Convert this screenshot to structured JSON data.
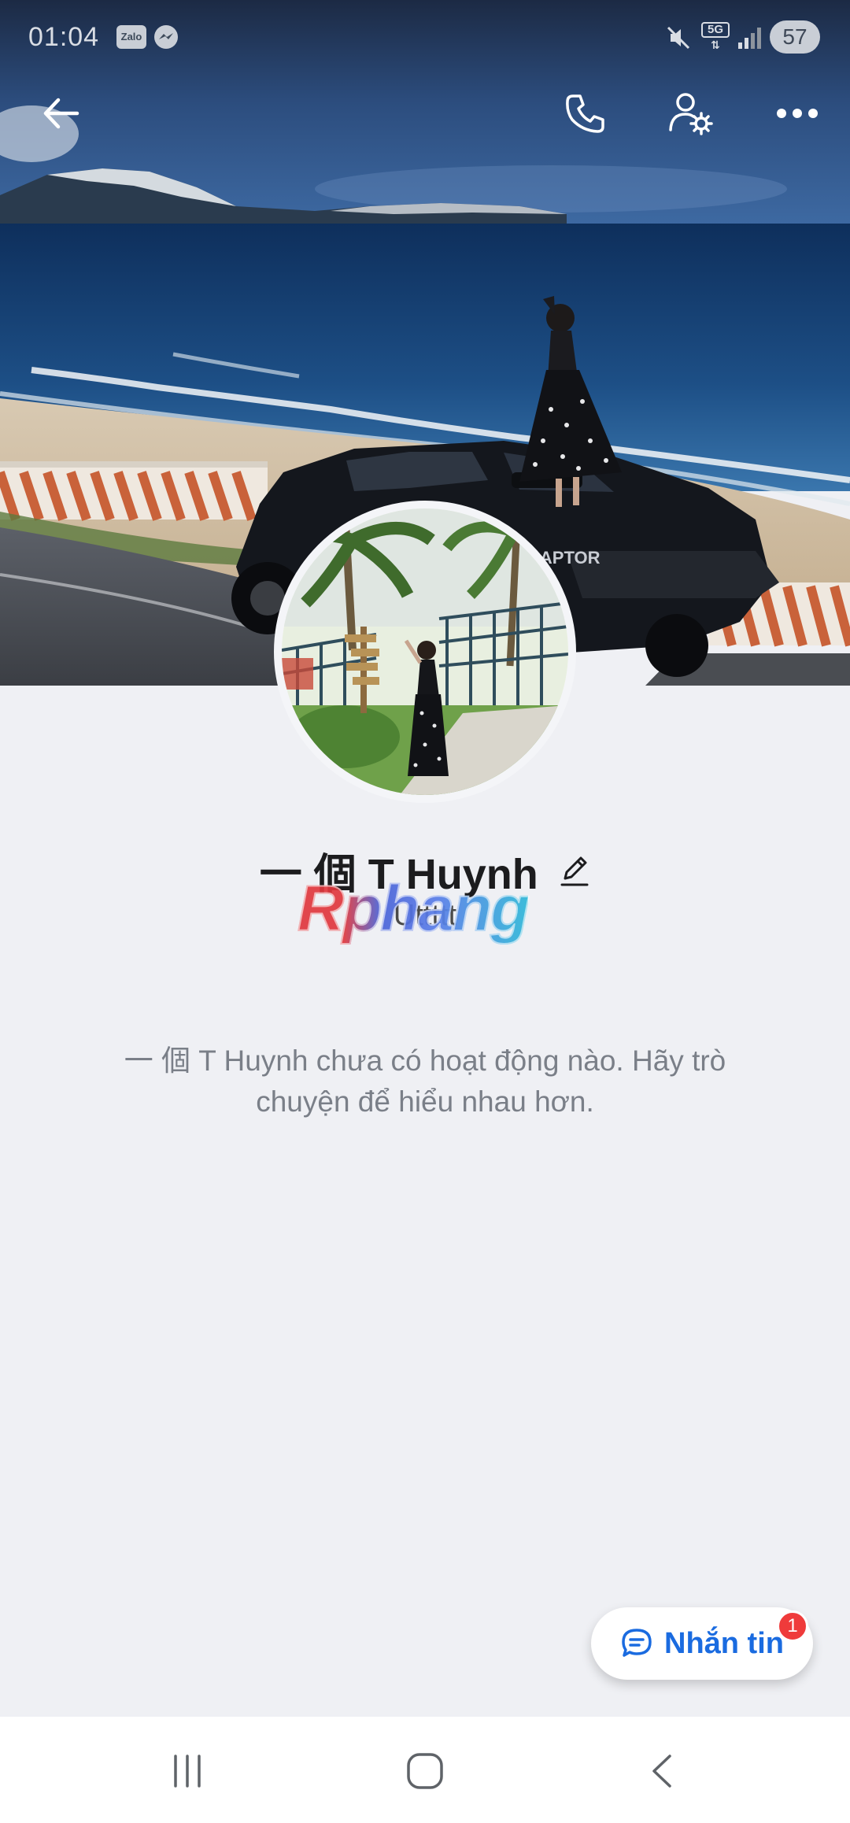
{
  "status_bar": {
    "time": "01:04",
    "app_badge": "Zalo",
    "network": "5G",
    "battery": "57"
  },
  "toolbar": {
    "back_icon": "arrow-left-icon",
    "call_icon": "phone-icon",
    "settings_icon": "user-gear-icon",
    "more_icon": "more-dots-icon"
  },
  "profile": {
    "display_name": "一 個 T Huynh",
    "status": "Uttttt",
    "watermark": "Rphang"
  },
  "activity": {
    "empty_message": "一 個 T Huynh chưa có hoạt động nào. Hãy trò chuyện để hiểu nhau hơn."
  },
  "message_button": {
    "label": "Nhắn tin",
    "badge_count": "1"
  },
  "colors": {
    "background": "#eff0f4",
    "accent": "#1a6be0",
    "badge": "#ef3b3b"
  }
}
